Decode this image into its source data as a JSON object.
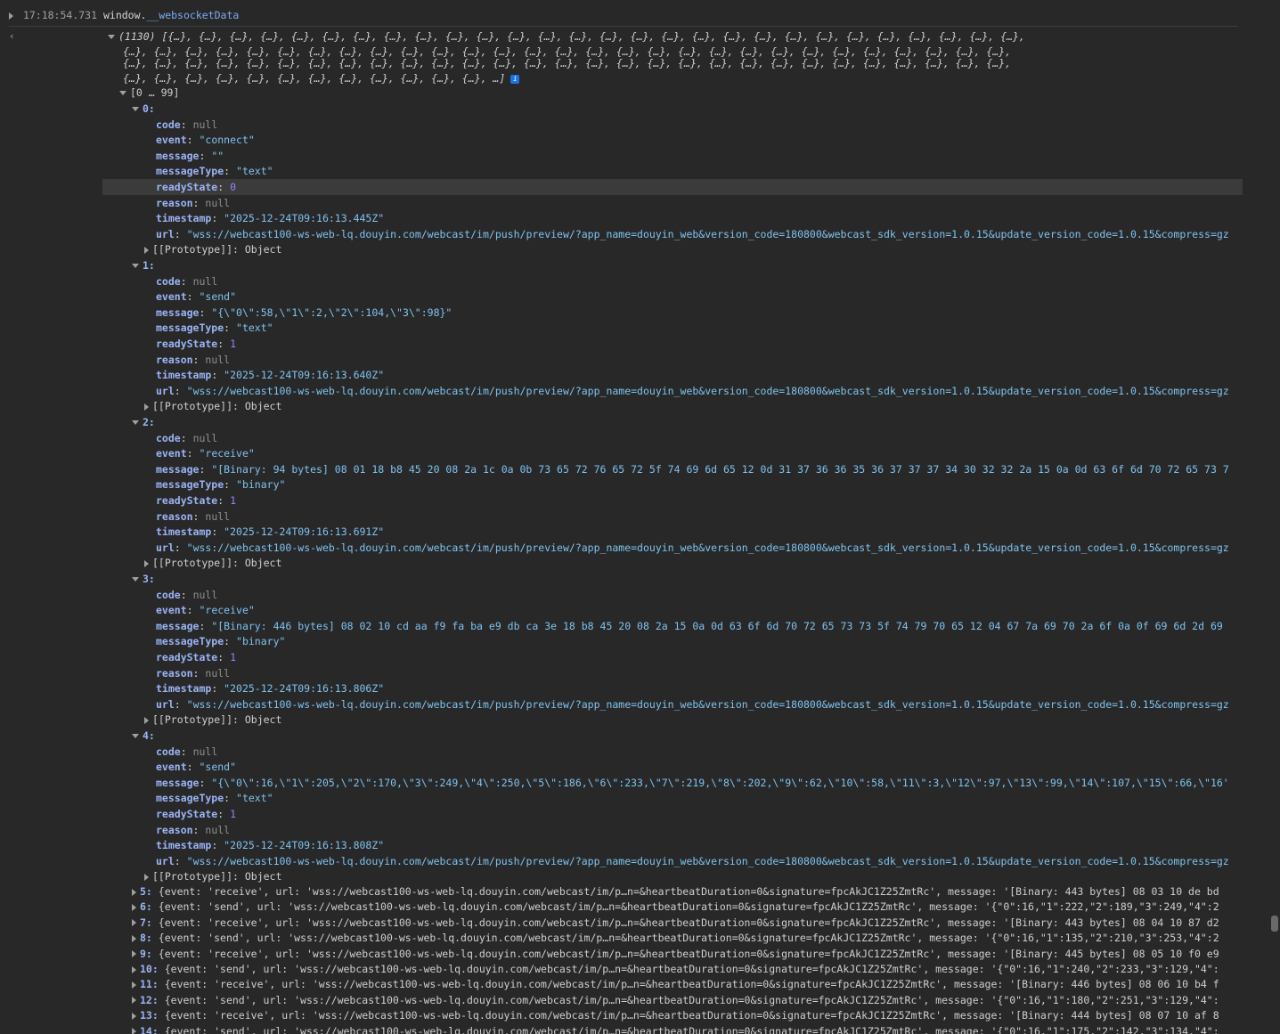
{
  "header": {
    "timestamp": "17:18:54.731",
    "expr_prefix": "window.",
    "expr_prop": "__websocketData"
  },
  "array": {
    "summary_1": "(1130) [{…}, {…}, {…}, {…}, {…}, {…}, {…}, {…}, {…}, {…}, {…}, {…}, {…}, {…}, {…}, {…}, {…}, {…}, {…}, {…}, {…}, {…}, {…}, {…}, {…}, {…}, {…}, {…},",
    "summary_2": "{…}, {…}, {…}, {…}, {…}, {…}, {…}, {…}, {…}, {…}, {…}, {…}, {…}, {…}, {…}, {…}, {…}, {…}, {…}, {…}, {…}, {…}, {…}, {…}, {…}, {…}, {…}, {…}, {…},",
    "summary_3": "{…}, {…}, {…}, {…}, {…}, {…}, {…}, {…}, {…}, {…}, {…}, {…}, {…}, {…}, {…}, {…}, {…}, {…}, {…}, {…}, {…}, {…}, {…}, {…}, {…}, {…}, {…}, {…}, {…},",
    "summary_4": "{…}, {…}, {…}, {…}, {…}, {…}, {…}, {…}, {…}, {…}, {…}, {…}, …]",
    "range": "[0 … 99]"
  },
  "entries": [
    {
      "index": "0:",
      "code": "null",
      "event": "\"connect\"",
      "message": "\"\"",
      "messageType": "\"text\"",
      "readyState": "0",
      "reason": "null",
      "timestamp": "\"2025-12-24T09:16:13.445Z\"",
      "url": "\"wss://webcast100-ws-web-lq.douyin.com/webcast/im/push/preview/?app_name=douyin_web&version_code=180800&webcast_sdk_version=1.0.15&update_version_code=1.0.15&compress=gz",
      "proto": "[[Prototype]]: Object"
    },
    {
      "index": "1:",
      "code": "null",
      "event": "\"send\"",
      "message": "\"{\\\"0\\\":58,\\\"1\\\":2,\\\"2\\\":104,\\\"3\\\":98}\"",
      "messageType": "\"text\"",
      "readyState": "1",
      "reason": "null",
      "timestamp": "\"2025-12-24T09:16:13.640Z\"",
      "url": "\"wss://webcast100-ws-web-lq.douyin.com/webcast/im/push/preview/?app_name=douyin_web&version_code=180800&webcast_sdk_version=1.0.15&update_version_code=1.0.15&compress=gz",
      "proto": "[[Prototype]]: Object"
    },
    {
      "index": "2:",
      "code": "null",
      "event": "\"receive\"",
      "message": "\"[Binary: 94 bytes] 08 01 18 b8 45 20 08 2a 1c 0a 0b 73 65 72 76 65 72 5f 74 69 6d 65 12 0d 31 37 36 36 35 36 37 37 37 34 30 32 32 2a 15 0a 0d 63 6f 6d 70 72 65 73 7",
      "messageType": "\"binary\"",
      "readyState": "1",
      "reason": "null",
      "timestamp": "\"2025-12-24T09:16:13.691Z\"",
      "url": "\"wss://webcast100-ws-web-lq.douyin.com/webcast/im/push/preview/?app_name=douyin_web&version_code=180800&webcast_sdk_version=1.0.15&update_version_code=1.0.15&compress=gz",
      "proto": "[[Prototype]]: Object"
    },
    {
      "index": "3:",
      "code": "null",
      "event": "\"receive\"",
      "message": "\"[Binary: 446 bytes] 08 02 10 cd aa f9 fa ba e9 db ca 3e 18 b8 45 20 08 2a 15 0a 0d 63 6f 6d 70 72 65 73 73 5f 74 79 70 65 12 04 67 7a 69 70 2a 6f 0a 0f 69 6d 2d 69",
      "messageType": "\"binary\"",
      "readyState": "1",
      "reason": "null",
      "timestamp": "\"2025-12-24T09:16:13.806Z\"",
      "url": "\"wss://webcast100-ws-web-lq.douyin.com/webcast/im/push/preview/?app_name=douyin_web&version_code=180800&webcast_sdk_version=1.0.15&update_version_code=1.0.15&compress=gz",
      "proto": "[[Prototype]]: Object"
    },
    {
      "index": "4:",
      "code": "null",
      "event": "\"send\"",
      "message": "\"{\\\"0\\\":16,\\\"1\\\":205,\\\"2\\\":170,\\\"3\\\":249,\\\"4\\\":250,\\\"5\\\":186,\\\"6\\\":233,\\\"7\\\":219,\\\"8\\\":202,\\\"9\\\":62,\\\"10\\\":58,\\\"11\\\":3,\\\"12\\\":97,\\\"13\\\":99,\\\"14\\\":107,\\\"15\\\":66,\\\"16'",
      "messageType": "\"text\"",
      "readyState": "1",
      "reason": "null",
      "timestamp": "\"2025-12-24T09:16:13.808Z\"",
      "url": "\"wss://webcast100-ws-web-lq.douyin.com/webcast/im/push/preview/?app_name=douyin_web&version_code=180800&webcast_sdk_version=1.0.15&update_version_code=1.0.15&compress=gz",
      "proto": "[[Prototype]]: Object"
    }
  ],
  "keys": {
    "code": "code",
    "event": "event",
    "message": "message",
    "messageType": "messageType",
    "readyState": "readyState",
    "reason": "reason",
    "timestamp": "timestamp",
    "url": "url"
  },
  "collapsed": [
    {
      "index": "5:",
      "text": "{event: 'receive', url: 'wss://webcast100-ws-web-lq.douyin.com/webcast/im/p…n=&heartbeatDuration=0&signature=fpcAkJC1Z25ZmtRc', message: '[Binary: 443 bytes] 08 03 10 de bd"
    },
    {
      "index": "6:",
      "text": "{event: 'send', url: 'wss://webcast100-ws-web-lq.douyin.com/webcast/im/p…n=&heartbeatDuration=0&signature=fpcAkJC1Z25ZmtRc', message: '{\"0\":16,\"1\":222,\"2\":189,\"3\":249,\"4\":2"
    },
    {
      "index": "7:",
      "text": "{event: 'receive', url: 'wss://webcast100-ws-web-lq.douyin.com/webcast/im/p…n=&heartbeatDuration=0&signature=fpcAkJC1Z25ZmtRc', message: '[Binary: 443 bytes] 08 04 10 87 d2"
    },
    {
      "index": "8:",
      "text": "{event: 'send', url: 'wss://webcast100-ws-web-lq.douyin.com/webcast/im/p…n=&heartbeatDuration=0&signature=fpcAkJC1Z25ZmtRc', message: '{\"0\":16,\"1\":135,\"2\":210,\"3\":253,\"4\":2"
    },
    {
      "index": "9:",
      "text": "{event: 'receive', url: 'wss://webcast100-ws-web-lq.douyin.com/webcast/im/p…n=&heartbeatDuration=0&signature=fpcAkJC1Z25ZmtRc', message: '[Binary: 445 bytes] 08 05 10 f0 e9"
    },
    {
      "index": "10:",
      "text": "{event: 'send', url: 'wss://webcast100-ws-web-lq.douyin.com/webcast/im/p…n=&heartbeatDuration=0&signature=fpcAkJC1Z25ZmtRc', message: '{\"0\":16,\"1\":240,\"2\":233,\"3\":129,\"4\":"
    },
    {
      "index": "11:",
      "text": "{event: 'receive', url: 'wss://webcast100-ws-web-lq.douyin.com/webcast/im/p…n=&heartbeatDuration=0&signature=fpcAkJC1Z25ZmtRc', message: '[Binary: 446 bytes] 08 06 10 b4 f"
    },
    {
      "index": "12:",
      "text": "{event: 'send', url: 'wss://webcast100-ws-web-lq.douyin.com/webcast/im/p…n=&heartbeatDuration=0&signature=fpcAkJC1Z25ZmtRc', message: '{\"0\":16,\"1\":180,\"2\":251,\"3\":129,\"4\":"
    },
    {
      "index": "13:",
      "text": "{event: 'receive', url: 'wss://webcast100-ws-web-lq.douyin.com/webcast/im/p…n=&heartbeatDuration=0&signature=fpcAkJC1Z25ZmtRc', message: '[Binary: 444 bytes] 08 07 10 af 8"
    },
    {
      "index": "14:",
      "text": "{event: 'send', url: 'wss://webcast100-ws-web-lq.douyin.com/webcast/im/p…n=&heartbeatDuration=0&signature=fpcAkJC1Z25ZmtRc', message: '{\"0\":16,\"1\":175,\"2\":142,\"3\":134,\"4\":"
    }
  ]
}
